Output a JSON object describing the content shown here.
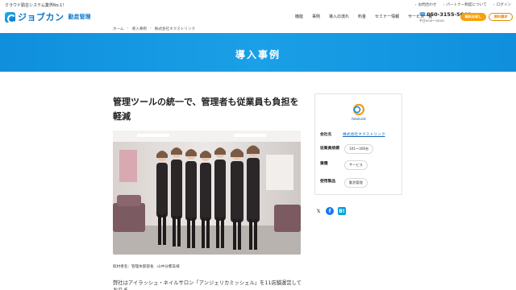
{
  "topbar": {
    "tagline": "クラウド勤怠システム業界No.1！",
    "links": [
      "お問合わせ",
      "パートナー制度について",
      "ログイン"
    ]
  },
  "header": {
    "logo_main": "ジョブカン",
    "logo_sub": "勤怠管理",
    "nav": [
      "機能",
      "事例",
      "導入の流れ",
      "料金",
      "セミナー情報",
      "サービス一覧"
    ],
    "phone": "050-3155-5640",
    "phone_hours": "平日9:00～18:00",
    "free_label": "無料お試し",
    "doc_label": "資料請求"
  },
  "breadcrumb": [
    "ホーム",
    "導入事例",
    "株式会社ネクストリンク"
  ],
  "hero_title": "導入事例",
  "article": {
    "title": "管理ツールの統一で、管理者も従業員も負担を軽減",
    "caption": "取材者名：管理本部部長　山中分都美様",
    "body": "弊社はアイラッシュ・ネイルサロン「アンジェリカミッシェル」を11店舗運営しておりま"
  },
  "company_card": {
    "logo_text": "NextLink",
    "rows": {
      "company_label": "会社名",
      "company_value": "株式会社ネクストリンク",
      "employees_label": "従業員規模",
      "employees_value": "101～300名",
      "industry_label": "業種",
      "industry_value": "サービス",
      "product_label": "使用製品",
      "product_value": "勤怠管理"
    }
  },
  "share": {
    "x_icon": "x-icon",
    "facebook_icon": "facebook-icon",
    "hatena_icon": "hatena-icon"
  },
  "colors": {
    "brand": "#0d78c9",
    "hero": "#1aa0e6",
    "accent": "#f5a10a"
  }
}
